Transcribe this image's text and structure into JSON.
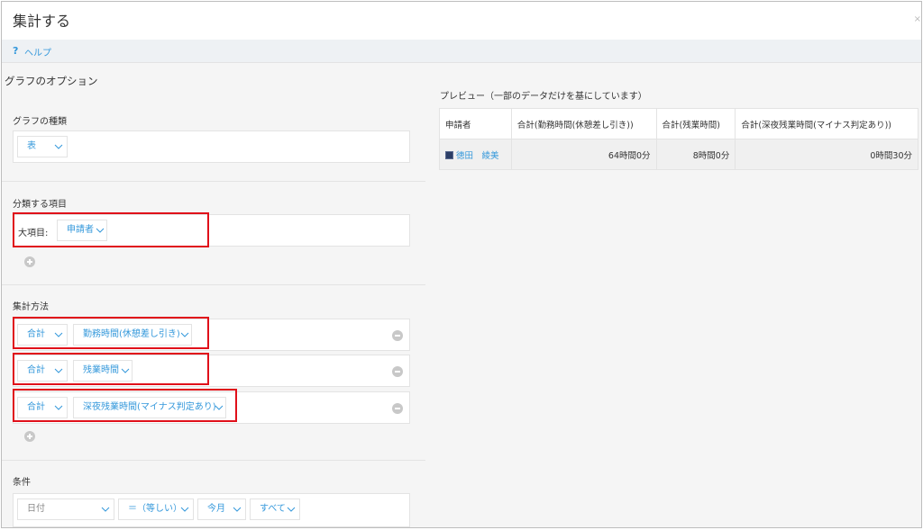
{
  "dialog": {
    "title": "集計する",
    "close_label": "×",
    "help": {
      "icon": "question-icon",
      "icon_glyph": "?",
      "label": "ヘルプ"
    }
  },
  "options": {
    "section_title": "グラフのオプション",
    "graph_type": {
      "label": "グラフの種類",
      "value": "表"
    },
    "group_by": {
      "label": "分類する項目",
      "major_label": "大項目:",
      "major_value": "申請者"
    },
    "aggregation": {
      "label": "集計方法",
      "rows": [
        {
          "func": "合計",
          "field": "勤務時間(休憩差し引き)"
        },
        {
          "func": "合計",
          "field": "残業時間"
        },
        {
          "func": "合計",
          "field": "深夜残業時間(マイナス判定あり)"
        }
      ]
    },
    "conditions": {
      "label": "条件",
      "field": "日付",
      "operator": "＝（等しい）",
      "period": "今月",
      "scope": "すべて"
    }
  },
  "preview": {
    "title": "プレビュー（一部のデータだけを基にしています）",
    "columns": [
      "申請者",
      "合計(勤務時間(休憩差し引き))",
      "合計(残業時間)",
      "合計(深夜残業時間(マイナス判定あり))"
    ],
    "rows": [
      {
        "applicant": "徳田　綾美",
        "work_time": "64時間0分",
        "overtime": "8時間0分",
        "late_night": "0時間30分"
      }
    ]
  },
  "colors": {
    "accent": "#3498db",
    "highlight": "#e0101a",
    "background": "#f5f5f5"
  }
}
